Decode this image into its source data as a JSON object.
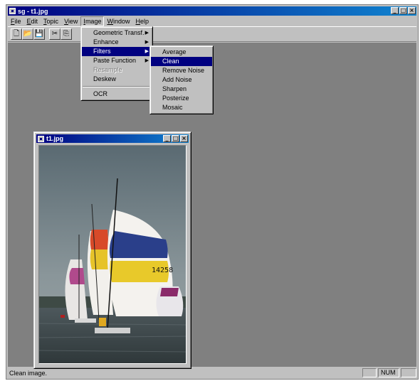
{
  "app": {
    "title": "sg - t1.jpg",
    "window_buttons": [
      "_",
      "□",
      "×"
    ]
  },
  "menubar": {
    "items": [
      {
        "label": "File",
        "mnemonic": "F",
        "rest": "ile"
      },
      {
        "label": "Edit",
        "mnemonic": "E",
        "rest": "dit"
      },
      {
        "label": "Topic",
        "mnemonic": "T",
        "rest": "opic"
      },
      {
        "label": "View",
        "mnemonic": "V",
        "rest": "iew"
      },
      {
        "label": "Image",
        "mnemonic": "I",
        "rest": "mage"
      },
      {
        "label": "Window",
        "mnemonic": "W",
        "rest": "indow"
      },
      {
        "label": "Help",
        "mnemonic": "H",
        "rest": "elp"
      }
    ]
  },
  "toolbar": {
    "buttons": [
      {
        "icon": "new-file-icon",
        "glyph": "🗋"
      },
      {
        "icon": "open-folder-icon",
        "glyph": "📂"
      },
      {
        "icon": "save-icon",
        "glyph": "💾"
      },
      {
        "icon": "cut-icon",
        "glyph": "✂"
      },
      {
        "icon": "copy-icon",
        "glyph": "⎘"
      }
    ]
  },
  "image_menu": {
    "items": [
      {
        "label": "Geometric Transf.",
        "submenu": true
      },
      {
        "label": "Enhance",
        "submenu": true
      },
      {
        "label": "Filters",
        "submenu": true,
        "selected": true
      },
      {
        "label": "Paste Function",
        "submenu": true
      },
      {
        "label": "Resample",
        "disabled": true
      },
      {
        "label": "Deskew"
      },
      {
        "label": "OCR"
      }
    ]
  },
  "filters_menu": {
    "items": [
      "Average",
      "Clean",
      "Remove Noise",
      "Add Noise",
      "Sharpen",
      "Posterize",
      "Mosaic"
    ],
    "selected": "Clean"
  },
  "child_window": {
    "title": "t1.jpg",
    "image_description_icon": "sailboats-photo",
    "sail_number": "14258"
  },
  "statusbar": {
    "text": "Clean image.",
    "num": "NUM"
  },
  "colors": {
    "titlebar": "#000080",
    "face": "#c0c0c0",
    "mdi_background": "#808080",
    "selection": "#000080"
  }
}
